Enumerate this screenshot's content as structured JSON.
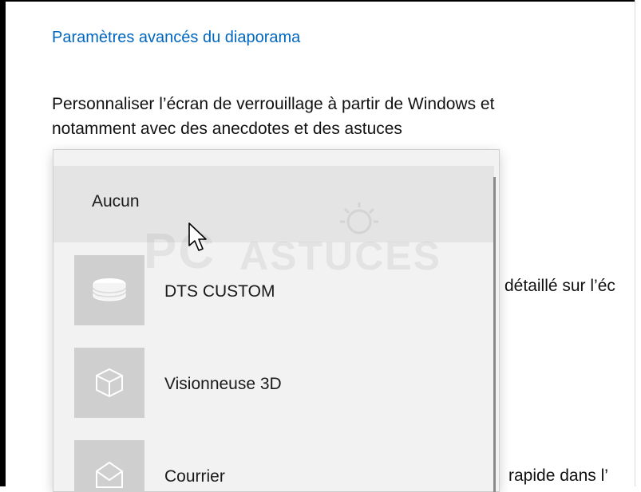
{
  "settings": {
    "advanced_link": "Paramètres avancés du diaporama",
    "description_line1": "Personnaliser l’écran de verrouillage à partir de Windows et",
    "description_line2": "notamment avec des anecdotes et des astuces",
    "side_text_1": "détaillé sur l’éc",
    "side_text_2": "rapide dans l’"
  },
  "dropdown": {
    "none_label": "Aucun",
    "apps": [
      {
        "label": "DTS CUSTOM",
        "icon": "dts-disc-icon"
      },
      {
        "label": "Visionneuse 3D",
        "icon": "cube-icon"
      },
      {
        "label": "Courrier",
        "icon": "mail-icon"
      }
    ]
  },
  "watermark": {
    "text_pc": "PC",
    "text_astuces": "ASTUCES"
  },
  "colors": {
    "link": "#0067c0",
    "tile": "#cfcfcf",
    "selected": "#e4e4e4"
  }
}
